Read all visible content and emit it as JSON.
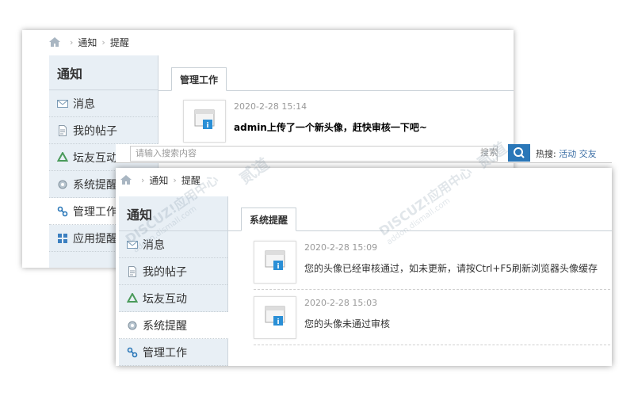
{
  "back": {
    "breadcrumb": {
      "level1": "通知",
      "level2": "提醒"
    },
    "sidebar": {
      "title": "通知",
      "items": [
        {
          "label": "消息",
          "icon": "envelope-icon"
        },
        {
          "label": "我的帖子",
          "icon": "document-icon"
        },
        {
          "label": "坛友互动",
          "icon": "recycle-icon"
        },
        {
          "label": "系统提醒",
          "icon": "gear-icon"
        },
        {
          "label": "管理工作",
          "icon": "link-icon"
        },
        {
          "label": "应用提醒",
          "icon": "grid-icon"
        }
      ]
    },
    "tab": "管理工作",
    "notices": [
      {
        "time": "2020-2-28 15:14",
        "message": "admin上传了一个新头像，赶快审核一下吧~"
      }
    ]
  },
  "searchbar": {
    "placeholder": "请输入搜索内容",
    "select": "搜索",
    "quick_label": "热搜:",
    "quick_links": [
      "活动",
      "交友"
    ]
  },
  "front": {
    "breadcrumb": {
      "level1": "通知",
      "level2": "提醒"
    },
    "sidebar": {
      "title": "通知",
      "items": [
        {
          "label": "消息",
          "icon": "envelope-icon"
        },
        {
          "label": "我的帖子",
          "icon": "document-icon"
        },
        {
          "label": "坛友互动",
          "icon": "recycle-icon"
        },
        {
          "label": "系统提醒",
          "icon": "gear-icon"
        },
        {
          "label": "管理工作",
          "icon": "link-icon"
        }
      ]
    },
    "tab": "系统提醒",
    "notices": [
      {
        "time": "2020-2-28 15:09",
        "message": "您的头像已经审核通过，如未更新，请按Ctrl+F5刷新浏览器头像缓存"
      },
      {
        "time": "2020-2-28 15:03",
        "message": "您的头像未通过审核"
      }
    ]
  },
  "watermark": {
    "brand": "DISCUZ!应用中心",
    "site": "addon.dismall.com",
    "mark": "贰道"
  },
  "colors": {
    "sidebar_bg": "#e8eff5",
    "accent": "#2a77b8",
    "icon_blue": "#2a8fd6"
  }
}
